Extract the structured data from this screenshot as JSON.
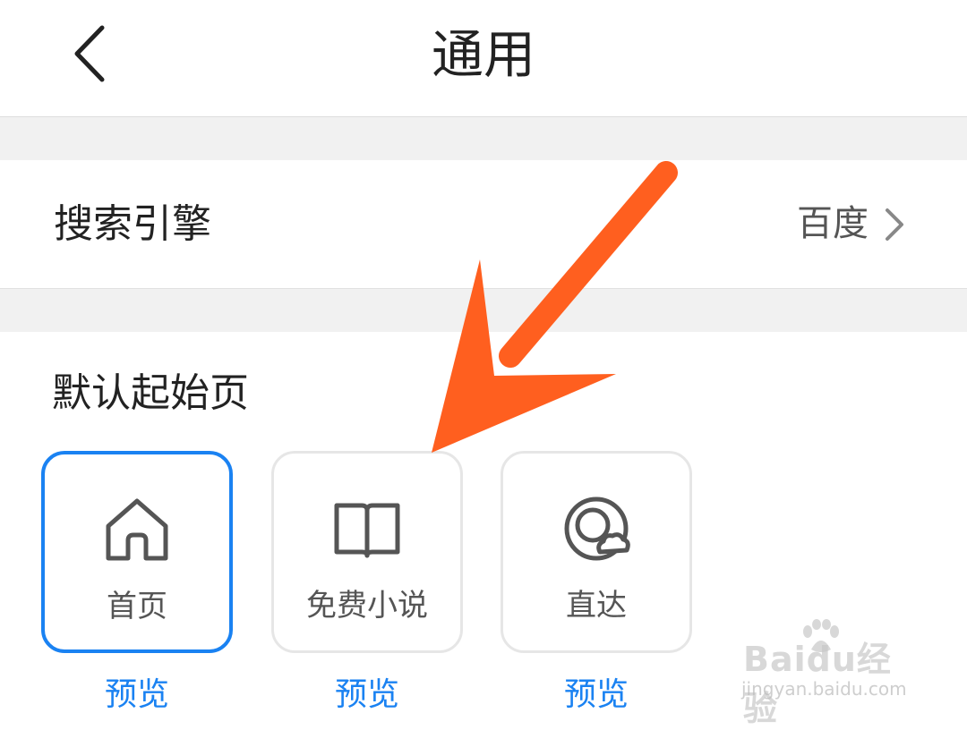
{
  "header": {
    "title": "通用",
    "back_icon": "chevron-left-icon"
  },
  "search_engine": {
    "label": "搜索引擎",
    "value": "百度",
    "chevron_icon": "chevron-right-icon"
  },
  "start_page": {
    "title": "默认起始页",
    "options": [
      {
        "label": "首页",
        "icon": "home-icon",
        "selected": true,
        "preview": "预览"
      },
      {
        "label": "免费小说",
        "icon": "book-icon",
        "selected": false,
        "preview": "预览"
      },
      {
        "label": "直达",
        "icon": "direct-icon",
        "selected": false,
        "preview": "预览"
      }
    ]
  },
  "watermark": {
    "brand": "Baidu经验",
    "url": "jingyan.baidu.com"
  },
  "colors": {
    "accent": "#1a82f2",
    "annotation_arrow": "#ff5f1f",
    "divider": "#f1f1f1"
  }
}
